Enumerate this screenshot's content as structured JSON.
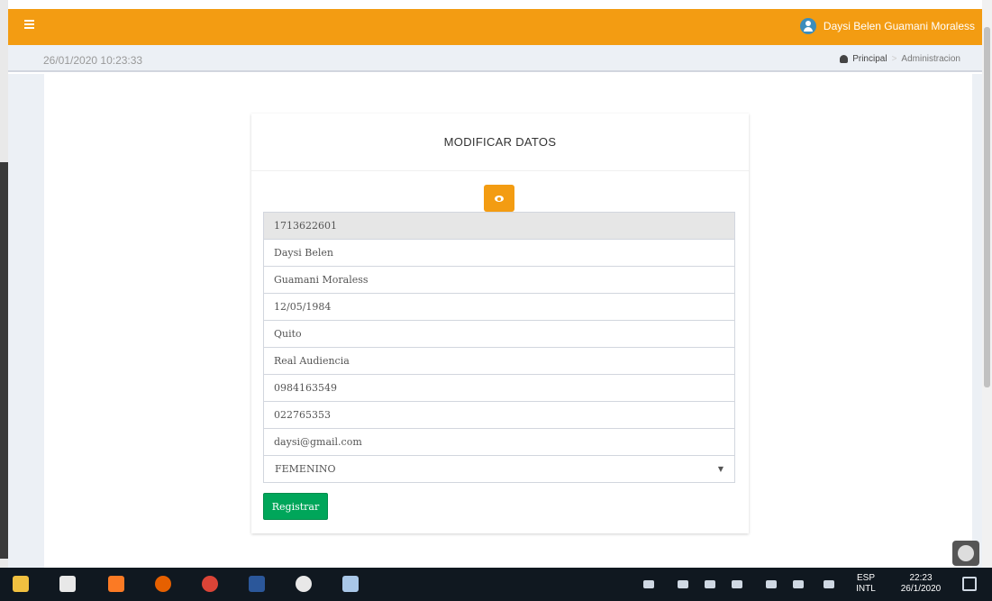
{
  "header": {
    "user_name": "Daysi Belen Guamani Moraless",
    "accent_color": "#f39c12"
  },
  "subheader": {
    "datetime": "26/01/2020 10:23:33",
    "breadcrumb": {
      "home": "Principal",
      "current": "Administracion"
    }
  },
  "form": {
    "title": "MODIFICAR DATOS",
    "fields": [
      {
        "value": "1713622601"
      },
      {
        "value": "Daysi Belen"
      },
      {
        "value": "Guamani Moraless"
      },
      {
        "value": "12/05/1984"
      },
      {
        "value": "Quito"
      },
      {
        "value": "Real Audiencia"
      },
      {
        "value": "0984163549"
      },
      {
        "value": "022765353"
      },
      {
        "value": "daysi@gmail.com"
      }
    ],
    "gender_selected": "FEMENINO",
    "submit_label": "Registrar",
    "submit_color": "#00a65a"
  },
  "taskbar": {
    "apps": [
      "file-explorer-icon",
      "mail-icon",
      "xampp-icon",
      "firefox-icon",
      "chrome-icon",
      "word-icon",
      "settings-icon",
      "paint-icon"
    ],
    "language_line1": "ESP",
    "language_line2": "INTL",
    "time": "22:23",
    "date": "26/1/2020"
  }
}
